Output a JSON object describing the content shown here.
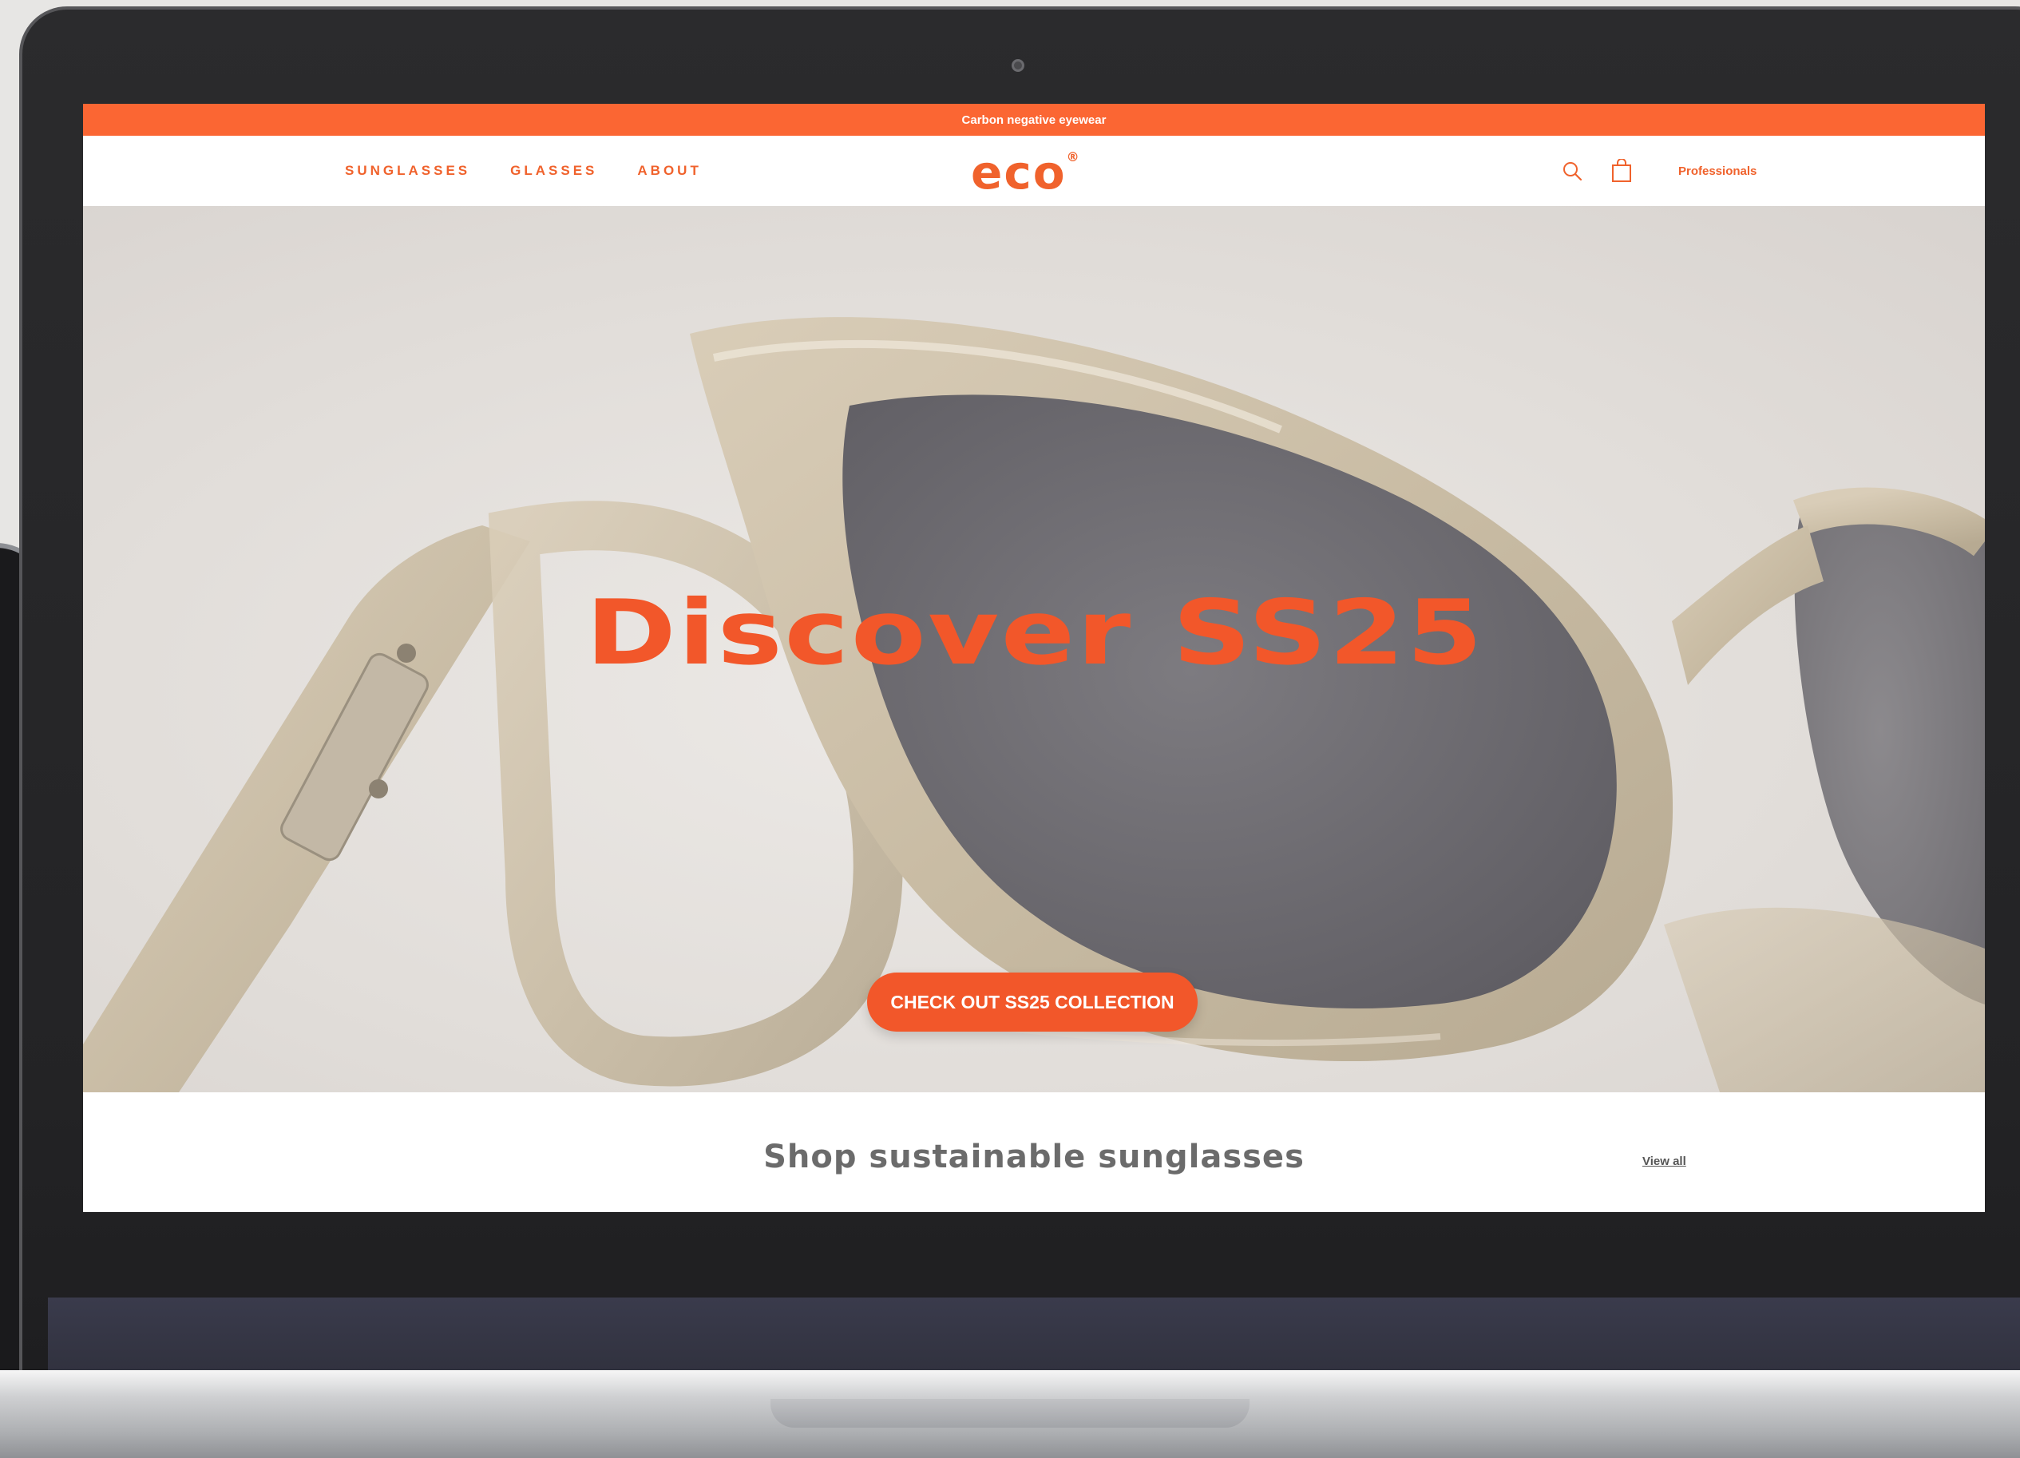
{
  "announcement": {
    "text": "Carbon negative eyewear"
  },
  "nav": {
    "links": [
      "SUNGLASSES",
      "GLASSES",
      "ABOUT"
    ],
    "logo": "eco",
    "logo_mark": "®",
    "search_icon": "search-icon",
    "bag_icon": "shopping-bag-icon",
    "professionals": "Professionals"
  },
  "hero": {
    "title": "Discover SS25",
    "cta": "CHECK OUT SS25 COLLECTION"
  },
  "shop": {
    "title": "Shop sustainable sunglasses",
    "view_all": "View all"
  },
  "colors": {
    "brand_orange": "#f2572a",
    "announcement_bg": "#fb6633",
    "laptop_body": "#2b2b2d",
    "hero_bg": "#e1ddd9"
  }
}
